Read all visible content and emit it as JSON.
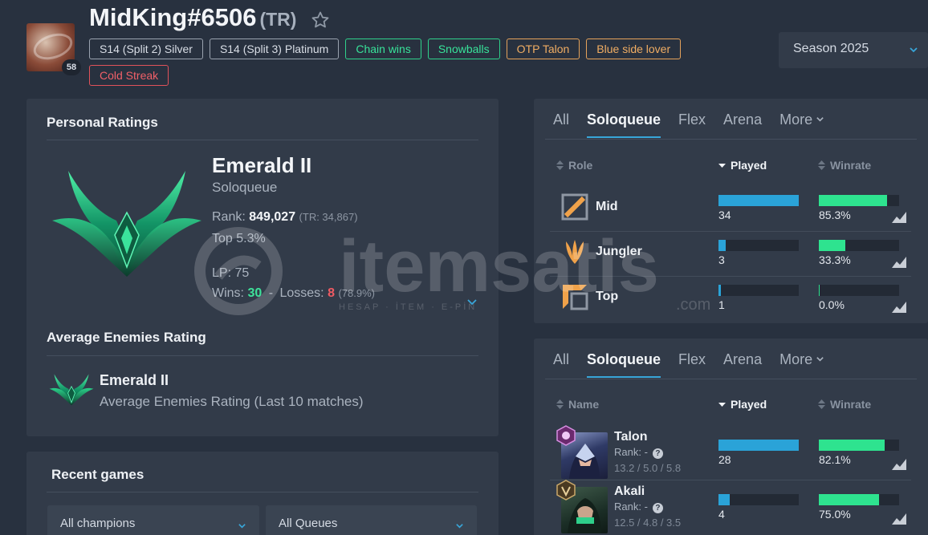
{
  "profile": {
    "summoner_name": "MidKing#6506",
    "region": "(TR)",
    "level": "58",
    "badges": [
      {
        "label": "S14 (Split 2) Silver",
        "color": "gray"
      },
      {
        "label": "S14 (Split 3) Platinum",
        "color": "gray"
      },
      {
        "label": "Chain wins",
        "color": "green"
      },
      {
        "label": "Snowballs",
        "color": "green"
      },
      {
        "label": "OTP Talon",
        "color": "orange"
      },
      {
        "label": "Blue side lover",
        "color": "orange"
      },
      {
        "label": "Cold Streak",
        "color": "red"
      }
    ]
  },
  "season_select": {
    "value": "Season 2025"
  },
  "personal_ratings": {
    "title": "Personal Ratings",
    "rank": "Emerald II",
    "queue": "Soloqueue",
    "rank_label": "Rank:",
    "rank_value": "849,027",
    "tr_value": "(TR: 34,867)",
    "top": "Top 5.3%",
    "lp": "LP: 75",
    "wins_label": "Wins:",
    "wins": "30",
    "separator": "-",
    "losses_label": "Losses:",
    "losses": "8",
    "winrate": "(78.9%)",
    "emblem_color": "#1f9e6a"
  },
  "average_enemies": {
    "title": "Average Enemies Rating",
    "rank": "Emerald II",
    "subtitle": "Average Enemies Rating (Last 10 matches)"
  },
  "recent_games": {
    "title": "Recent games",
    "champion_filter": "All champions",
    "queue_filter": "All Queues"
  },
  "tabs": [
    "All",
    "Soloqueue",
    "Flex",
    "Arena",
    "More"
  ],
  "active_tab": "Soloqueue",
  "roles_table": {
    "headers": {
      "role": "Role",
      "played": "Played",
      "winrate": "Winrate"
    },
    "rows": [
      {
        "name": "Mid",
        "played": "34",
        "played_frac": 1.0,
        "winrate": "85.3%",
        "winrate_frac": 0.853,
        "icon": "mid-lane-icon"
      },
      {
        "name": "Jungler",
        "played": "3",
        "played_frac": 0.088,
        "winrate": "33.3%",
        "winrate_frac": 0.333,
        "icon": "jungle-icon"
      },
      {
        "name": "Top",
        "played": "1",
        "played_frac": 0.029,
        "winrate": "0.0%",
        "winrate_frac": 0.0,
        "icon": "top-lane-icon"
      }
    ]
  },
  "champions_table": {
    "headers": {
      "name": "Name",
      "played": "Played",
      "winrate": "Winrate"
    },
    "rows": [
      {
        "name": "Talon",
        "rank_label": "Rank: -",
        "kda": "13.2 / 5.0 / 5.8",
        "played": "28",
        "played_frac": 1.0,
        "winrate": "82.1%",
        "winrate_frac": 0.821
      },
      {
        "name": "Akali",
        "rank_label": "Rank: -",
        "kda": "12.5 / 4.8 / 3.5",
        "played": "4",
        "played_frac": 0.143,
        "winrate": "75.0%",
        "winrate_frac": 0.75
      }
    ]
  },
  "colors": {
    "played_bar": "#2aa3d8",
    "winrate_bar": "#2ee38f",
    "accent": "#38a6d9"
  },
  "watermark": {
    "brand": "itemsatis",
    "tagline": "HESAP · İTEM · E-PİN",
    "suffix": ".com"
  }
}
